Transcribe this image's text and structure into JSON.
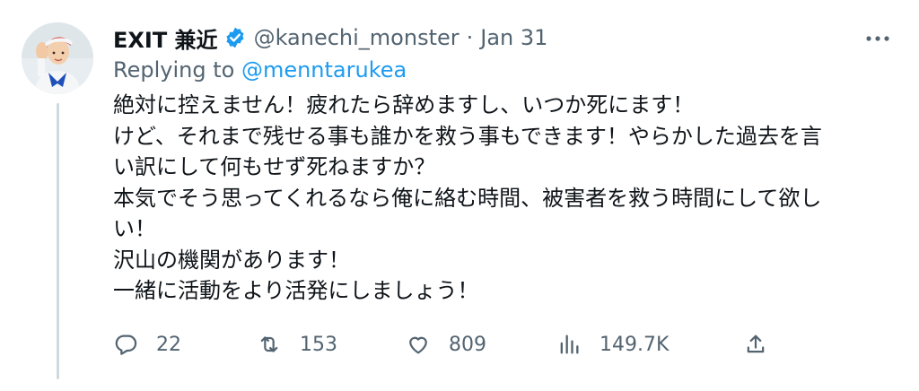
{
  "tweet": {
    "author_name": "EXIT 兼近",
    "handle": "@kanechi_monster",
    "separator": "·",
    "date": "Jan 31",
    "replying_prefix": "Replying to",
    "replying_handle": "@menntarukea",
    "body_lines": [
      "絶対に控えません！疲れたら辞めますし、いつか死にます！",
      "けど、それまで残せる事も誰かを救う事もできます！やらかした過去を言",
      "い訳にして何もせず死ねますか？",
      "本気でそう思ってくれるなら俺に絡む時間、被害者を救う時間にして欲し",
      "い！",
      "沢山の機関があります！",
      "一緒に活動をより活発にしましょう！"
    ],
    "stats": {
      "replies": "22",
      "retweets": "153",
      "likes": "809",
      "views": "149.7K"
    }
  },
  "icons": {
    "verified": "verified-badge-icon",
    "more": "more-dots-icon",
    "reply": "reply-bubble-icon",
    "retweet": "retweet-icon",
    "like": "heart-icon",
    "views": "analytics-bars-icon",
    "share": "share-upload-icon"
  },
  "colors": {
    "text": "#0f1419",
    "secondary": "#536471",
    "accent": "#1d9bf0",
    "thread_line": "#cfd9de"
  }
}
